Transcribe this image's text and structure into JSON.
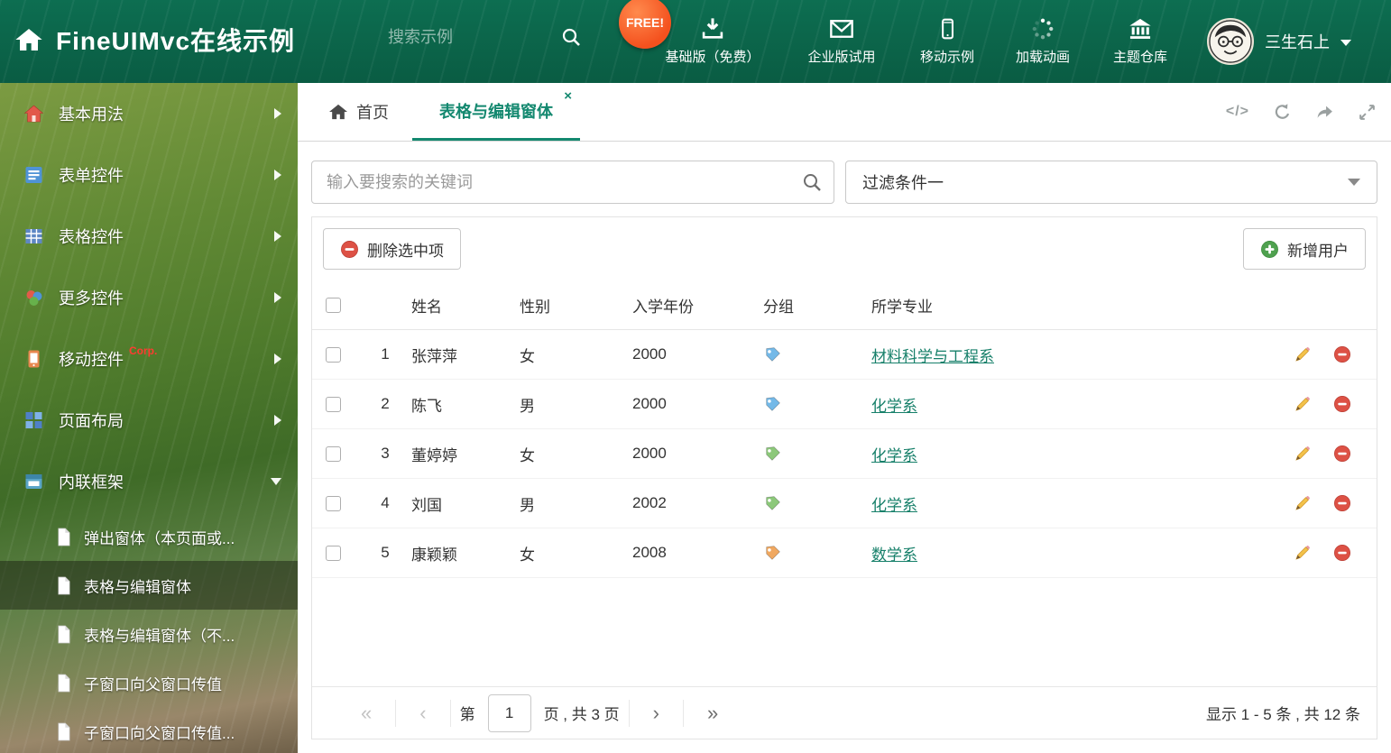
{
  "colors": {
    "header-bg": "#0d6e51",
    "accent": "#13886f",
    "link": "#17806a",
    "danger": "#dd5145",
    "success": "#4fa14f"
  },
  "header": {
    "logo_title": "FineUIMvc在线示例",
    "search_placeholder": "搜索示例",
    "free_badge": "FREE!",
    "nav": [
      {
        "label": "基础版（免费）"
      },
      {
        "label": "企业版试用"
      },
      {
        "label": "移动示例"
      },
      {
        "label": "加载动画"
      },
      {
        "label": "主题仓库"
      }
    ],
    "username": "三生石上"
  },
  "sidebar": {
    "items": [
      {
        "label": "基本用法"
      },
      {
        "label": "表单控件"
      },
      {
        "label": "表格控件"
      },
      {
        "label": "更多控件"
      },
      {
        "label": "移动控件",
        "badge": "Corp."
      },
      {
        "label": "页面布局"
      },
      {
        "label": "内联框架"
      }
    ],
    "subitems": [
      {
        "label": "弹出窗体（本页面或..."
      },
      {
        "label": "表格与编辑窗体"
      },
      {
        "label": "表格与编辑窗体（不..."
      },
      {
        "label": "子窗口向父窗口传值"
      },
      {
        "label": "子窗口向父窗口传值..."
      }
    ]
  },
  "tabs": {
    "home_label": "首页",
    "active_label": "表格与编辑窗体",
    "close_glyph": "×",
    "code_tool": "</>"
  },
  "filter": {
    "search_placeholder": "输入要搜索的关键词",
    "dropdown_value": "过滤条件一"
  },
  "grid": {
    "delete_button": "删除选中项",
    "add_button": "新增用户",
    "columns": [
      "姓名",
      "性别",
      "入学年份",
      "分组",
      "所学专业"
    ],
    "rows": [
      {
        "num": "1",
        "name": "张萍萍",
        "gender": "女",
        "year": "2000",
        "tag_color": "#74b9e8",
        "major": "材料科学与工程系"
      },
      {
        "num": "2",
        "name": "陈飞",
        "gender": "男",
        "year": "2000",
        "tag_color": "#74b9e8",
        "major": "化学系"
      },
      {
        "num": "3",
        "name": "董婷婷",
        "gender": "女",
        "year": "2000",
        "tag_color": "#8cc87a",
        "major": "化学系"
      },
      {
        "num": "4",
        "name": "刘国",
        "gender": "男",
        "year": "2002",
        "tag_color": "#8cc87a",
        "major": "化学系"
      },
      {
        "num": "5",
        "name": "康颖颖",
        "gender": "女",
        "year": "2008",
        "tag_color": "#f0a860",
        "major": "数学系"
      }
    ]
  },
  "pagination": {
    "first_glyph": "«",
    "prev_glyph": "‹",
    "next_glyph": "›",
    "last_glyph": "»",
    "page_prefix": "第",
    "page_value": "1",
    "page_suffix": "页 , 共 3 页",
    "summary": "显示 1 - 5 条 , 共 12 条"
  }
}
